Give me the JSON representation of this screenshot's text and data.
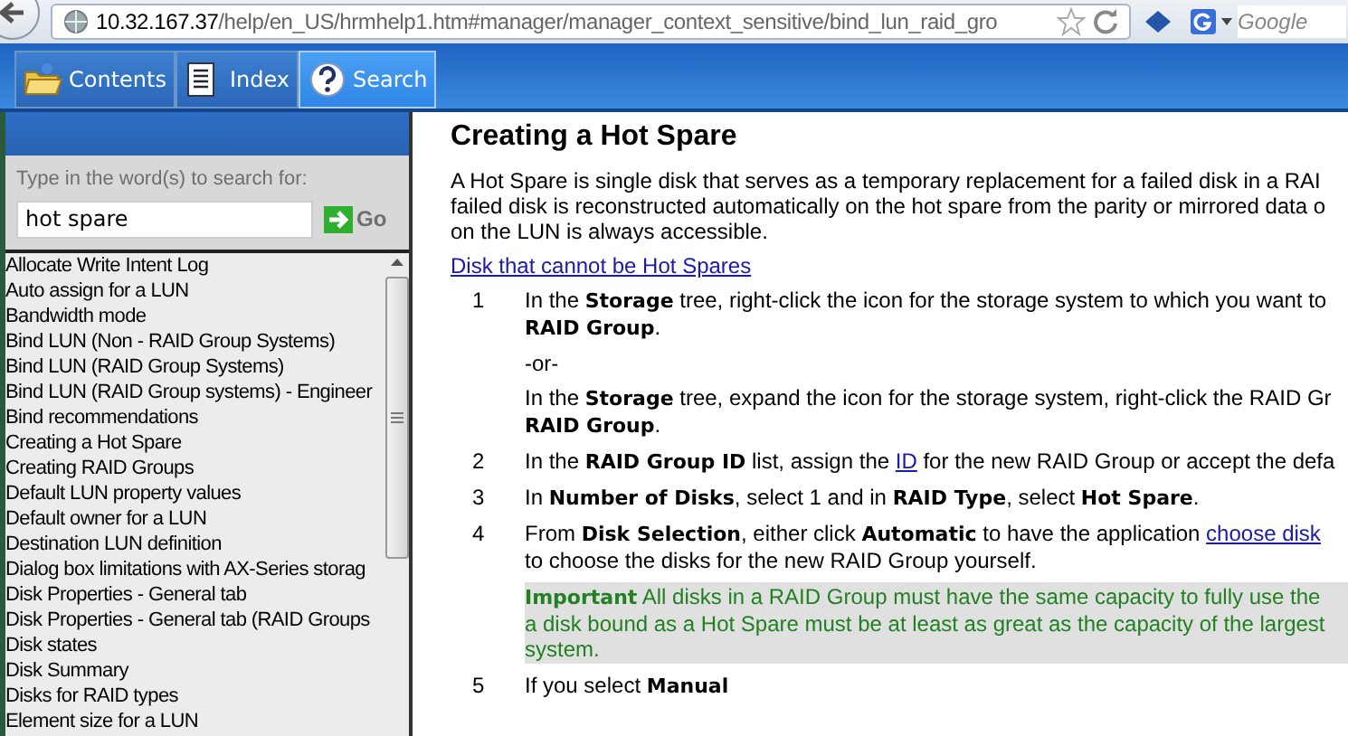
{
  "browser": {
    "url_host": "10.32.167.37",
    "url_path": "/help/en_US/hrmhelp1.htm#manager/manager_context_sensitive/bind_lun_raid_gro",
    "search_placeholder": "Google"
  },
  "tabs": [
    {
      "label": "Contents",
      "kind": "folder",
      "selected": false
    },
    {
      "label": "Index",
      "kind": "page",
      "selected": false
    },
    {
      "label": "Search",
      "kind": "question",
      "selected": true
    }
  ],
  "search_panel": {
    "prompt": "Type in the word(s) to search for:",
    "query": "hot spare",
    "go_label": "Go",
    "results": [
      {
        "label": "Allocate Write Intent Log",
        "selected": false
      },
      {
        "label": "Auto assign for a LUN",
        "selected": false
      },
      {
        "label": "Bandwidth mode",
        "selected": false
      },
      {
        "label": "Bind LUN (Non - RAID Group Systems)",
        "selected": false
      },
      {
        "label": "Bind LUN (RAID Group Systems)",
        "selected": false
      },
      {
        "label": "Bind LUN (RAID Group systems) - Engineer",
        "selected": false
      },
      {
        "label": "Bind recommendations",
        "selected": false
      },
      {
        "label": "Creating a Hot Spare",
        "selected": false
      },
      {
        "label": "Creating RAID Groups",
        "selected": false
      },
      {
        "label": "Default LUN property values",
        "selected": false
      },
      {
        "label": "Default owner for a LUN",
        "selected": false
      },
      {
        "label": "Destination LUN definition",
        "selected": false
      },
      {
        "label": "Dialog box limitations with AX-Series storag",
        "selected": false
      },
      {
        "label": "Disk Properties - General tab",
        "selected": false
      },
      {
        "label": "Disk Properties - General tab (RAID Groups",
        "selected": false
      },
      {
        "label": "Disk states",
        "selected": false
      },
      {
        "label": "Disk Summary",
        "selected": false
      },
      {
        "label": "Disks for RAID types",
        "selected": false
      },
      {
        "label": "Element size for a LUN",
        "selected": false
      }
    ]
  },
  "article": {
    "title": "Creating a Hot Spare",
    "intro_lines": [
      "A Hot Spare is single disk that serves as a temporary replacement for a failed disk in a RAI",
      "failed disk is reconstructed automatically on the hot spare from the parity or mirrored data o",
      "on the LUN is always accessible."
    ],
    "link": "Disk that cannot be Hot Spares",
    "steps": [
      {
        "number": "1",
        "blocks": [
          {
            "kind": "text",
            "lines": [
              [
                {
                  "kind": "text",
                  "text": "In the **Storage** tree, right-click the icon for the storage system to which you want to"
                }
              ],
              [
                {
                  "kind": "text",
                  "text": "**RAID Group**."
                }
              ]
            ]
          },
          {
            "kind": "text",
            "lines": [
              [
                {
                  "kind": "text",
                  "text": "-or-"
                }
              ]
            ]
          },
          {
            "kind": "text",
            "lines": [
              [
                {
                  "kind": "text",
                  "text": "In the **Storage** tree, expand the icon for the storage system, right-click the RAID Gr"
                }
              ],
              [
                {
                  "kind": "text",
                  "text": "**RAID Group**."
                }
              ]
            ]
          }
        ]
      },
      {
        "number": "2",
        "blocks": [
          {
            "kind": "text",
            "lines": [
              [
                {
                  "kind": "text",
                  "text": "In the **RAID Group ID** list, assign the "
                },
                {
                  "kind": "link",
                  "text": "ID"
                },
                {
                  "kind": "text",
                  "text": " for the new RAID Group or accept the defa"
                }
              ]
            ]
          }
        ]
      },
      {
        "number": "3",
        "blocks": [
          {
            "kind": "text",
            "lines": [
              [
                {
                  "kind": "text",
                  "text": "In **Number of Disks**, select 1 and in **RAID Type**, select **Hot Spare**."
                }
              ]
            ]
          }
        ]
      },
      {
        "number": "4",
        "blocks": [
          {
            "kind": "text",
            "lines": [
              [
                {
                  "kind": "text",
                  "text": "From **Disk Selection**, either click **Automatic** to have the application "
                },
                {
                  "kind": "link",
                  "text": "choose disk"
                }
              ],
              [
                {
                  "kind": "text",
                  "text": "to choose the disks for the new RAID Group yourself."
                }
              ]
            ]
          },
          {
            "kind": "note",
            "lines": [
              [
                {
                  "kind": "text",
                  "text": "**Important** All disks in a RAID Group must have the same capacity to fully use the"
                }
              ],
              [
                {
                  "kind": "text",
                  "text": "a disk bound as a Hot Spare must be at least as great as the capacity of the largest"
                }
              ],
              [
                {
                  "kind": "text",
                  "text": "system."
                }
              ]
            ]
          }
        ]
      },
      {
        "number": "5",
        "blocks": [
          {
            "kind": "text",
            "lines": [
              [
                {
                  "kind": "text",
                  "text": "If you select **Manual**"
                }
              ]
            ]
          }
        ]
      }
    ]
  }
}
